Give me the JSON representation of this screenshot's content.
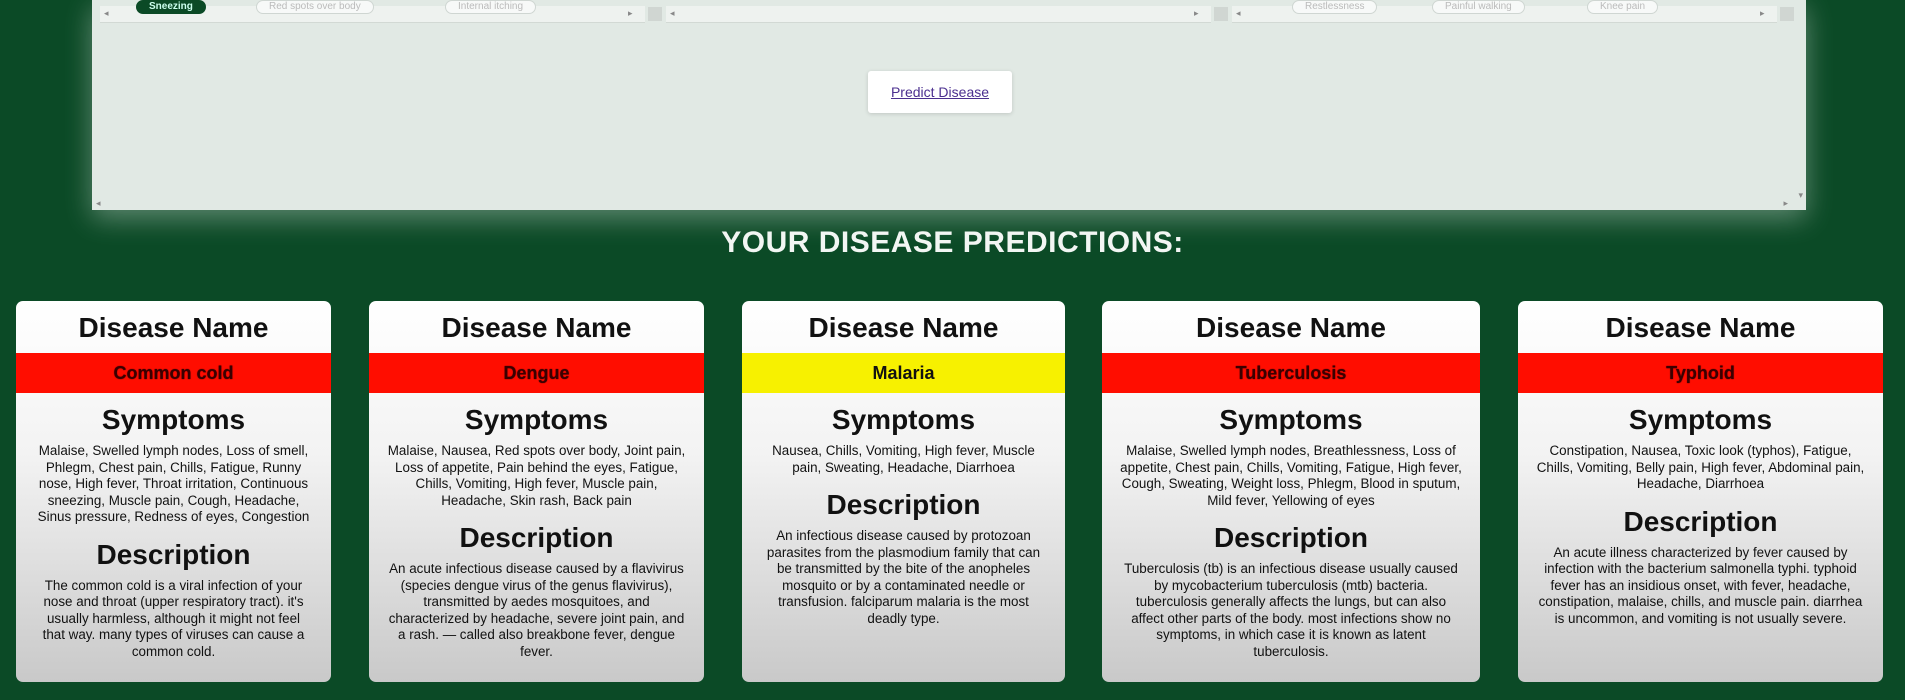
{
  "form": {
    "selected_symptoms_row": {
      "chips": [
        "Sneezing",
        "Red spots over body",
        "Internal itching",
        "Restlessness",
        "Painful walking",
        "Knee pain"
      ]
    },
    "predict_button_label": "Predict Disease"
  },
  "results": {
    "heading": "YOUR DISEASE PREDICTIONS:",
    "cards": [
      {
        "name_label": "Disease Name",
        "disease": "Common cold",
        "color": "#ff0d00",
        "symptoms_label": "Symptoms",
        "symptoms": "Malaise, Swelled lymph nodes, Loss of smell, Phlegm, Chest pain, Chills, Fatigue, Runny nose, High fever, Throat irritation, Continuous sneezing, Muscle pain, Cough, Headache, Sinus pressure, Redness of eyes, Congestion",
        "description_label": "Description",
        "description": "The common cold is a viral infection of your nose and throat (upper respiratory tract). it's usually harmless, although it might not feel that way. many types of viruses can cause a common cold."
      },
      {
        "name_label": "Disease Name",
        "disease": "Dengue",
        "color": "#ff0d00",
        "symptoms_label": "Symptoms",
        "symptoms": "Malaise, Nausea, Red spots over body, Joint pain, Loss of appetite, Pain behind the eyes, Fatigue, Chills, Vomiting, High fever, Muscle pain, Headache, Skin rash, Back pain",
        "description_label": "Description",
        "description": "An acute infectious disease caused by a flavivirus (species dengue virus of the genus flavivirus), transmitted by aedes mosquitoes, and characterized by headache, severe joint pain, and a rash. — called also breakbone fever, dengue fever."
      },
      {
        "name_label": "Disease Name",
        "disease": "Malaria",
        "color": "#f7f100",
        "symptoms_label": "Symptoms",
        "symptoms": "Nausea, Chills, Vomiting, High fever, Muscle pain, Sweating, Headache, Diarrhoea",
        "description_label": "Description",
        "description": "An infectious disease caused by protozoan parasites from the plasmodium family that can be transmitted by the bite of the anopheles mosquito or by a contaminated needle or transfusion. falciparum malaria is the most deadly type."
      },
      {
        "name_label": "Disease Name",
        "disease": "Tuberculosis",
        "color": "#ff0d00",
        "symptoms_label": "Symptoms",
        "symptoms": "Malaise, Swelled lymph nodes, Breathlessness, Loss of appetite, Chest pain, Chills, Vomiting, Fatigue, High fever, Cough, Sweating, Weight loss, Phlegm, Blood in sputum, Mild fever, Yellowing of eyes",
        "description_label": "Description",
        "description": "Tuberculosis (tb) is an infectious disease usually caused by mycobacterium tuberculosis (mtb) bacteria. tuberculosis generally affects the lungs, but can also affect other parts of the body. most infections show no symptoms, in which case it is known as latent tuberculosis."
      },
      {
        "name_label": "Disease Name",
        "disease": "Typhoid",
        "color": "#ff0d00",
        "symptoms_label": "Symptoms",
        "symptoms": "Constipation, Nausea, Toxic look (typhos), Fatigue, Chills, Vomiting, Belly pain, High fever, Abdominal pain, Headache, Diarrhoea",
        "description_label": "Description",
        "description": "An acute illness characterized by fever caused by infection with the bacterium salmonella typhi. typhoid fever has an insidious onset, with fever, headache, constipation, malaise, chills, and muscle pain. diarrhea is uncommon, and vomiting is not usually severe."
      }
    ]
  }
}
